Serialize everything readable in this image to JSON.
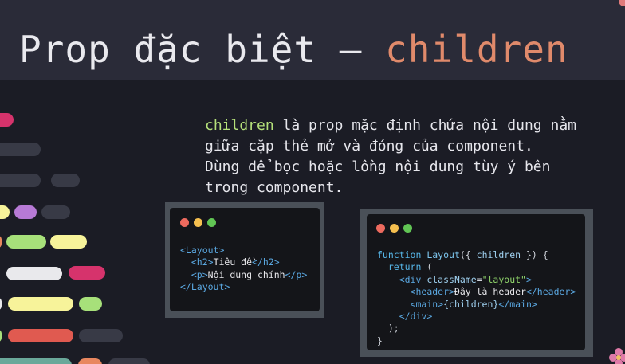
{
  "slide": {
    "title_plain": "Prop đặc biệt – ",
    "title_accent": "children",
    "desc_keyword": "children",
    "desc_line1_rest": " là prop mặc định chứa nội dung nằm",
    "desc_line2": "giữa cặp thẻ mở và đóng của component.",
    "desc_line3": "Dùng để bọc hoặc lồng nội dung tùy ý bên",
    "desc_line4": "trong component."
  },
  "colors": {
    "background": "#1b1c25",
    "header": "#2a2b38",
    "title_accent": "#e08a6b",
    "keyword": "#b5e07a",
    "dot_red": "#ed6a5e",
    "dot_yellow": "#f5bf4f",
    "dot_green": "#61c554"
  },
  "code_usage": {
    "open_tag": "<Layout>",
    "h2_open": "<h2>",
    "h2_text": "Tiêu đề",
    "h2_close": "</h2>",
    "p_open": "<p>",
    "p_text": "Nội dung chính",
    "p_close": "</p>",
    "close_tag": "</Layout>"
  },
  "code_component": {
    "kw_function": "function",
    "fn_name": "Layout",
    "params_open": "({ ",
    "param": "children",
    "params_close": " }) {",
    "kw_return": "return",
    "paren_open": " (",
    "div_open_start": "<div ",
    "attr_name": "className",
    "attr_eq": "=",
    "attr_value": "\"layout\"",
    "tag_end": ">",
    "header_open": "<header>",
    "header_text": "Đây là header",
    "header_close": "</header>",
    "main_open": "<main>",
    "main_expr": "{children}",
    "main_close": "</main>",
    "div_close": "</div>",
    "paren_close": ");",
    "brace_close": "}"
  }
}
